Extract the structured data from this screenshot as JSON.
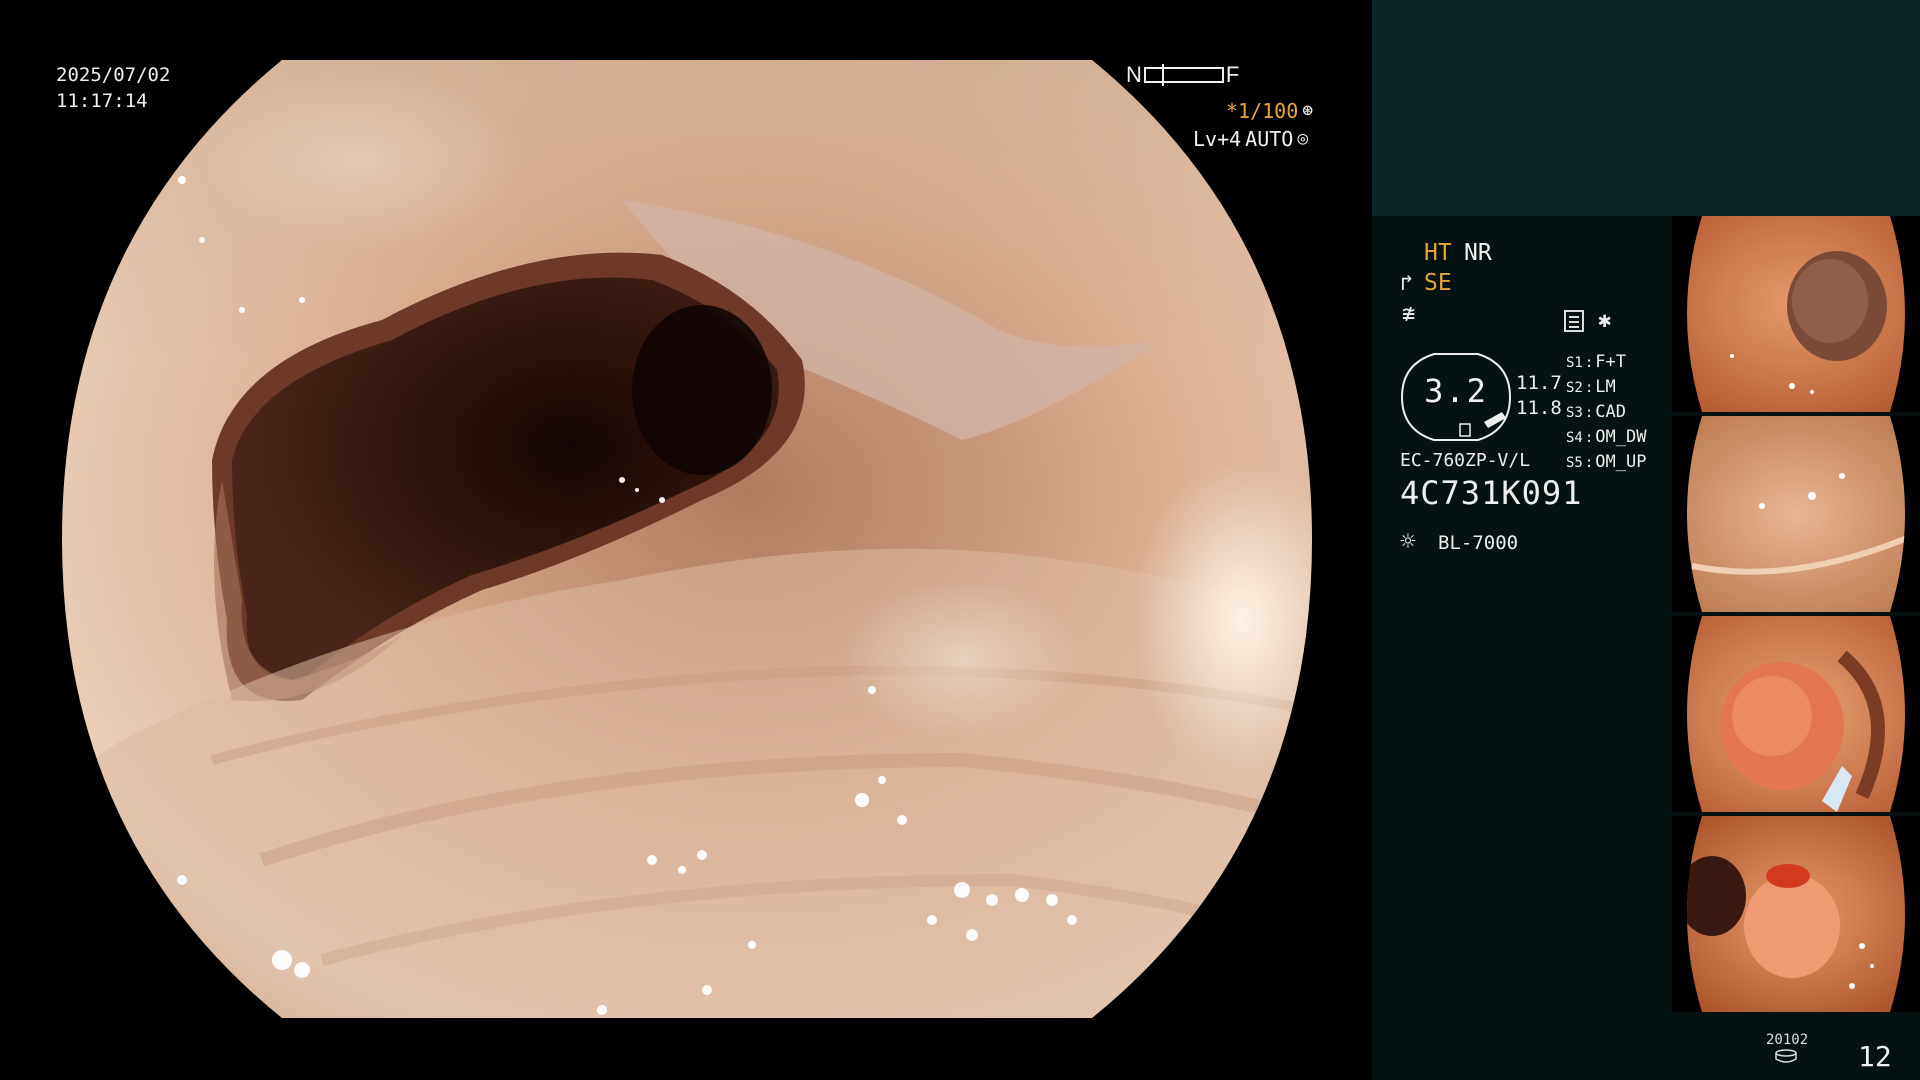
{
  "osd": {
    "date": "2025/07/02",
    "time": "11:17:14",
    "near_label": "N",
    "far_label": "F",
    "shutter_speed": "*1/100",
    "level": "Lv+4",
    "iris_mode": "AUTO"
  },
  "panel": {
    "ht_label": "HT",
    "nr_label": "NR",
    "se_label": "SE",
    "scope_value": "3.2",
    "value_a": "11.7",
    "value_b": "11.8",
    "switches": [
      {
        "key": "S1",
        "value": "F+T"
      },
      {
        "key": "S2",
        "value": "LM"
      },
      {
        "key": "S3",
        "value": "CAD"
      },
      {
        "key": "S4",
        "value": "OM_DW"
      },
      {
        "key": "S5",
        "value": "OM_UP"
      }
    ],
    "scope_model": "EC-760ZP-V/L",
    "scope_serial": "4C731K091",
    "lamp_model": "BL-7000",
    "footer_code": "20102",
    "image_count": "12"
  },
  "icons": {
    "nf_indicator": "near-far-indicator",
    "shutter": "shutter-icon",
    "iris": "iris-icon",
    "se_icon": "structure-enhancement-icon",
    "freeze": "freeze-icon",
    "memory": "memory-card-icon",
    "lamp": "light-source-icon",
    "disk": "disk-icon"
  },
  "colors": {
    "osd_text": "#f0f0f0",
    "accent_orange": "#e6a53a",
    "panel_bg": "#061212",
    "panel_top_bg": "#0b2626"
  }
}
